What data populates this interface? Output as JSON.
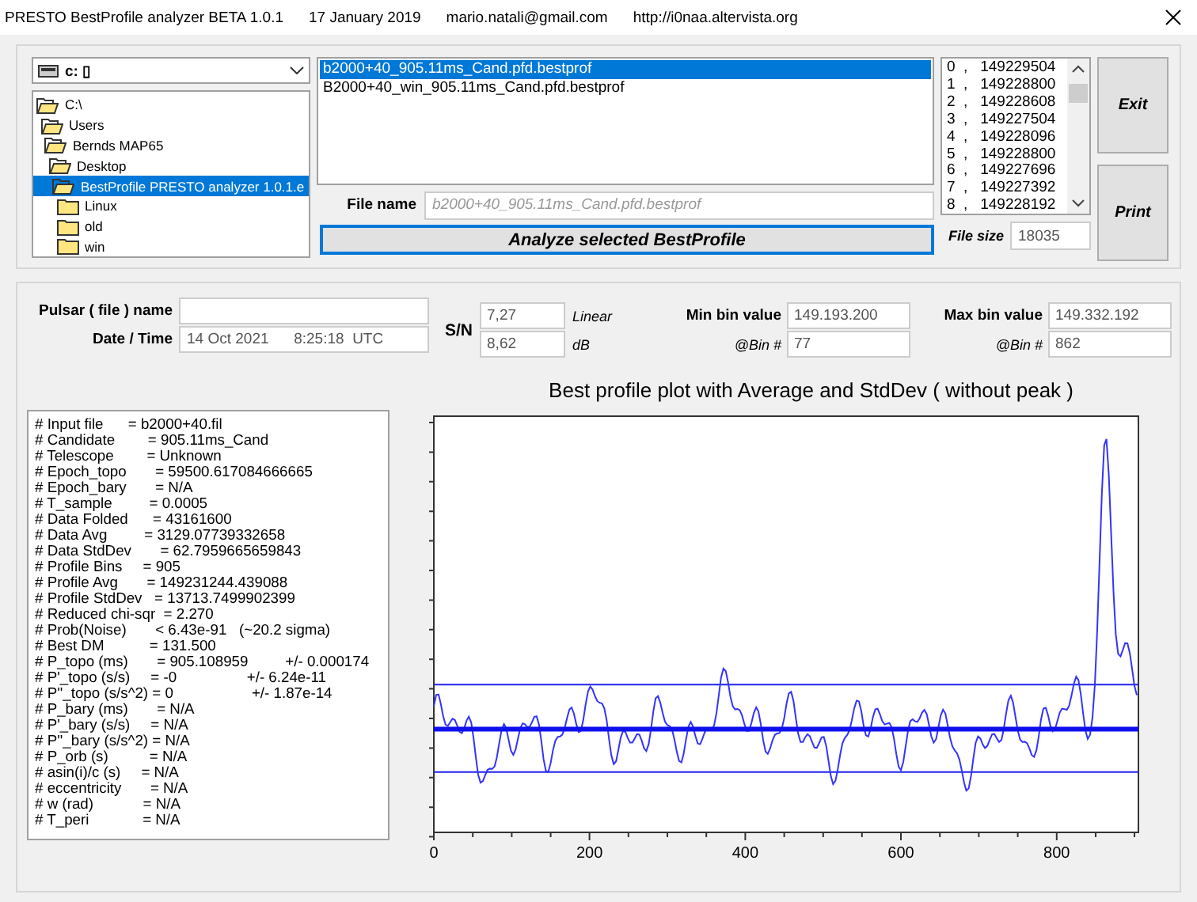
{
  "window": {
    "title": "PRESTO BestProfile analyzer BETA 1.0.1",
    "date": "17 January 2019",
    "email": "mario.natali@gmail.com",
    "url": "http://i0naa.altervista.org"
  },
  "drive": {
    "value": "c: ▯"
  },
  "folders": [
    {
      "label": "C:\\",
      "expanded": true,
      "selected": false,
      "children": [
        {
          "label": "Users",
          "expanded": true,
          "selected": false,
          "children": [
            {
              "label": "Bernds MAP65",
              "expanded": true,
              "selected": false,
              "children": [
                {
                  "label": "Desktop",
                  "expanded": true,
                  "selected": false,
                  "children": [
                    {
                      "label": "BestProfile PRESTO analyzer 1.0.1.e",
                      "expanded": true,
                      "selected": true,
                      "children": [
                        {
                          "label": "Linux",
                          "expanded": false,
                          "selected": false
                        },
                        {
                          "label": "old",
                          "expanded": false,
                          "selected": false
                        },
                        {
                          "label": "win",
                          "expanded": false,
                          "selected": false
                        }
                      ]
                    }
                  ]
                }
              ]
            }
          ]
        }
      ]
    }
  ],
  "files": [
    {
      "label": "b2000+40_905.11ms_Cand.pfd.bestprof",
      "selected": true
    },
    {
      "label": "B2000+40_win_905.11ms_Cand.pfd.bestprof",
      "selected": false
    }
  ],
  "file_name": {
    "label": "File name",
    "value": "b2000+40_905.11ms_Cand.pfd.bestprof",
    "disabled": true
  },
  "analyze_button": "Analyze selected BestProfile",
  "bins": [
    "0  ,   149229504",
    "1  ,   149228800",
    "2  ,   149228608",
    "3  ,   149227504",
    "4  ,   149228096",
    "5  ,   149228800",
    "6  ,   149227696",
    "7  ,   149227392",
    "8  ,   149228192"
  ],
  "file_size": {
    "label": "File size",
    "value": "18035"
  },
  "buttons": [
    "Exit",
    "Print"
  ],
  "pulsar": {
    "label": "Pulsar ( file ) name"
  },
  "date_time": {
    "label": "Date / Time",
    "date": "14 Oct 2021",
    "time": "8:25:18",
    "zone": "UTC"
  },
  "snr": {
    "label": "S/N",
    "rows": [
      {
        "value": "7,27",
        "unit": "Linear"
      },
      {
        "value": "8,62",
        "unit": "dB"
      }
    ]
  },
  "min_bin": {
    "label": "Min bin value",
    "value": "149.193.200",
    "bin_label": "@Bin #",
    "bin": "77"
  },
  "max_bin": {
    "label": "Max bin value",
    "value": "149.332.192",
    "bin_label": "@Bin #",
    "bin": "862"
  },
  "info_lines": [
    "# Input file      = b2000+40.fil",
    "# Candidate        = 905.11ms_Cand",
    "# Telescope        = Unknown",
    "# Epoch_topo       = 59500.617084666665",
    "# Epoch_bary       = N/A",
    "# T_sample         = 0.0005",
    "# Data Folded      = 43161600",
    "# Data Avg         = 3129.07739332658",
    "# Data StdDev       = 62.7959665659843",
    "# Profile Bins     = 905",
    "# Profile Avg       = 149231244.439088",
    "# Profile StdDev   = 13713.7499902399",
    "# Reduced chi-sqr  = 2.270",
    "# Prob(Noise)       < 6.43e-91   (~20.2 sigma)",
    "# Best DM           = 131.500",
    "# P_topo (ms)       = 905.108959         +/- 0.000174",
    "# P'_topo (s/s)     = -0                 +/- 6.24e-11",
    "# P''_topo (s/s^2) = 0                   +/- 1.87e-14",
    "# P_bary (ms)       = N/A",
    "# P'_bary (s/s)     = N/A",
    "# P''_bary (s/s^2) = N/A",
    "# P_orb (s)          = N/A",
    "# asin(i)/c (s)     = N/A",
    "# eccentricity       = N/A",
    "# w (rad)            = N/A",
    "# T_peri             = N/A"
  ],
  "plot": {
    "title": "Best profile plot with  Average and StdDev ( without peak )",
    "x_tick_labels": [
      "0",
      "200",
      "400",
      "600",
      "800"
    ]
  }
}
